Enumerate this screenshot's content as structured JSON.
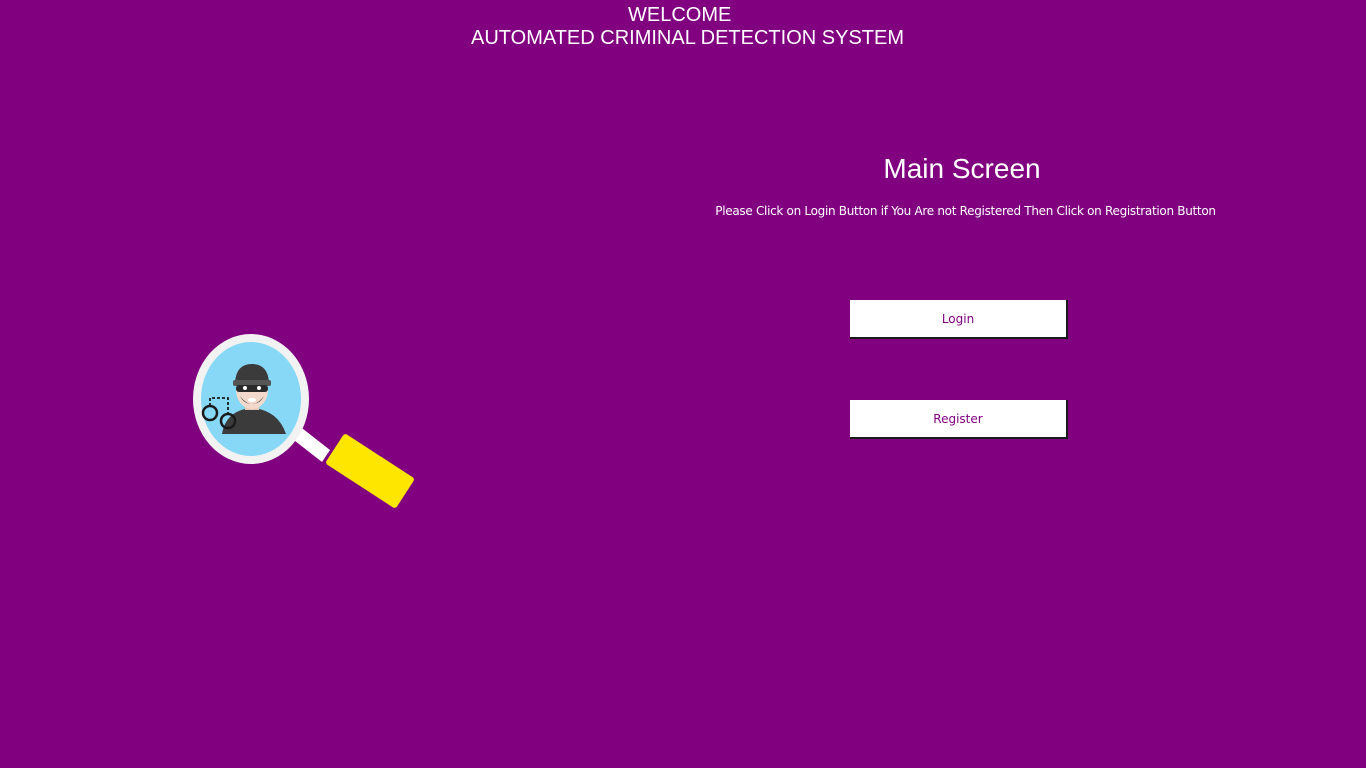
{
  "header": {
    "welcome": "WELCOME",
    "system_title": "AUTOMATED CRIMINAL DETECTION SYSTEM"
  },
  "main": {
    "title": "Main Screen",
    "instructions": "Please Click on Login Button if You Are not Registered Then Click on Registration Button",
    "login_label": "Login",
    "register_label": "Register"
  },
  "illustration": {
    "icon": "magnifier-criminal-icon"
  },
  "colors": {
    "background": "#800080",
    "button_bg": "#ffffff",
    "button_text": "#800080",
    "text": "#ffffff",
    "magnifier_handle": "#ffe600",
    "lens_fill": "#87d8f7"
  }
}
